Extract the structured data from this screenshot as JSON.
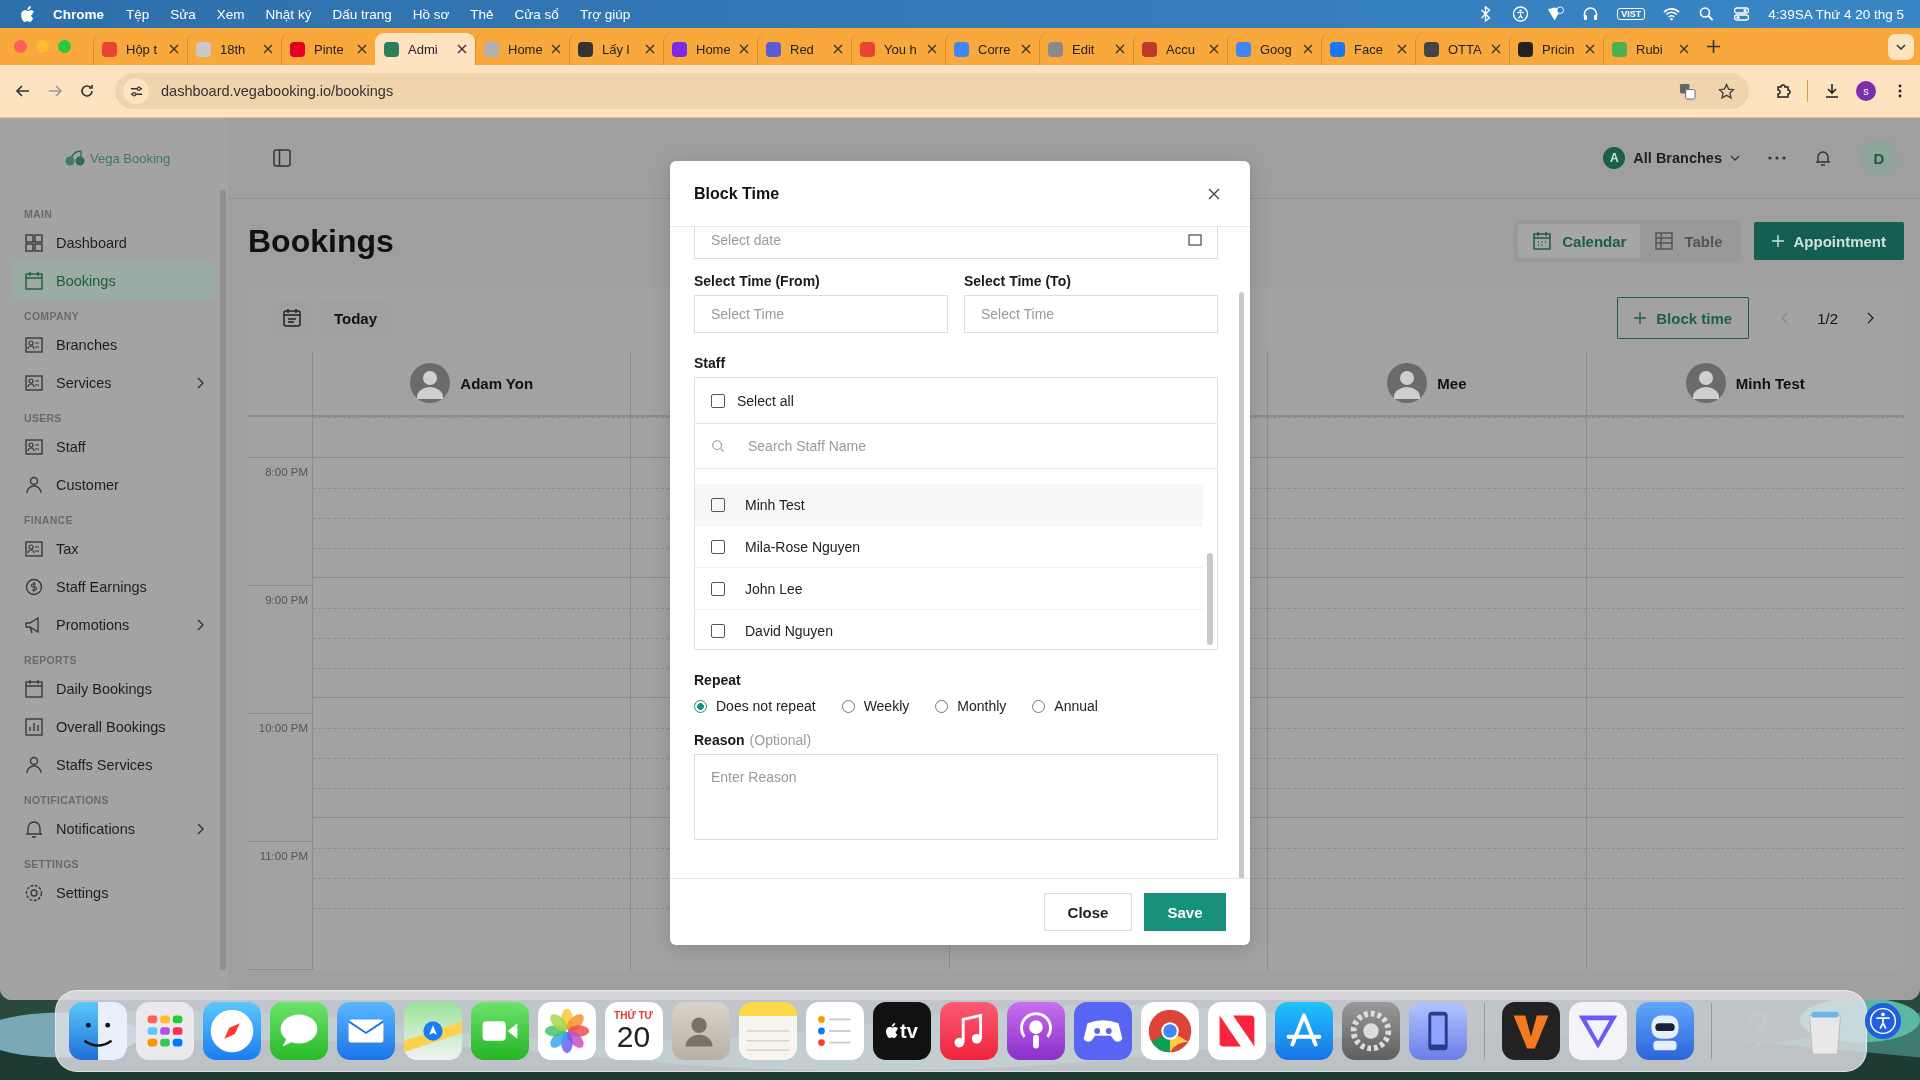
{
  "menu_bar": {
    "app": "Chrome",
    "items": [
      "Tệp",
      "Sửa",
      "Xem",
      "Nhật ký",
      "Dấu trang",
      "Hồ sơ",
      "Thẻ",
      "Cửa sổ",
      "Trợ giúp"
    ],
    "input_source": "VIST",
    "clock": "4:39SA Thứ 4 20 thg 5"
  },
  "browser": {
    "tabs": [
      {
        "title": "Hộp t",
        "color": "#ea4335",
        "selected": false
      },
      {
        "title": "18th",
        "color": "#c9c9c9",
        "selected": false
      },
      {
        "title": "Pinte",
        "color": "#e60023",
        "selected": false
      },
      {
        "title": "Admi",
        "color": "#2e7d5b",
        "selected": true
      },
      {
        "title": "Home",
        "color": "#b0b0b0",
        "selected": false
      },
      {
        "title": "Lấy l",
        "color": "#333333",
        "selected": false
      },
      {
        "title": "Home",
        "color": "#7d2ae8",
        "selected": false
      },
      {
        "title": "Red",
        "color": "#5b5bd6",
        "selected": false
      },
      {
        "title": "You h",
        "color": "#ea4335",
        "selected": false
      },
      {
        "title": "Corre",
        "color": "#4285f4",
        "selected": false
      },
      {
        "title": "Edit",
        "color": "#8a8a8a",
        "selected": false
      },
      {
        "title": "Accu",
        "color": "#c0392b",
        "selected": false
      },
      {
        "title": "Goog",
        "color": "#4285f4",
        "selected": false
      },
      {
        "title": "Face",
        "color": "#1877f2",
        "selected": false
      },
      {
        "title": "OTTA",
        "color": "#444444",
        "selected": false
      },
      {
        "title": "Pricin",
        "color": "#222222",
        "selected": false
      },
      {
        "title": "Rubi",
        "color": "#4caf50",
        "selected": false
      }
    ],
    "url": "dashboard.vegabooking.io/bookings",
    "profile_initial": "s"
  },
  "app": {
    "logo": "Vega Booking",
    "sidebar": [
      {
        "heading": "MAIN",
        "items": [
          {
            "label": "Dashboard",
            "selected": false,
            "has_submenu": false
          },
          {
            "label": "Bookings",
            "selected": true,
            "has_submenu": false
          }
        ]
      },
      {
        "heading": "COMPANY",
        "items": [
          {
            "label": "Branches",
            "selected": false,
            "has_submenu": false
          },
          {
            "label": "Services",
            "selected": false,
            "has_submenu": true
          }
        ]
      },
      {
        "heading": "USERS",
        "items": [
          {
            "label": "Staff",
            "selected": false,
            "has_submenu": false
          },
          {
            "label": "Customer",
            "selected": false,
            "has_submenu": false
          }
        ]
      },
      {
        "heading": "FINANCE",
        "items": [
          {
            "label": "Tax",
            "selected": false,
            "has_submenu": false
          },
          {
            "label": "Staff Earnings",
            "selected": false,
            "has_submenu": false
          },
          {
            "label": "Promotions",
            "selected": false,
            "has_submenu": true
          }
        ]
      },
      {
        "heading": "REPORTS",
        "items": [
          {
            "label": "Daily Bookings",
            "selected": false,
            "has_submenu": false
          },
          {
            "label": "Overall Bookings",
            "selected": false,
            "has_submenu": false
          },
          {
            "label": "Staffs Services",
            "selected": false,
            "has_submenu": false
          }
        ]
      },
      {
        "heading": "NOTIFICATIONS",
        "items": [
          {
            "label": "Notifications",
            "selected": false,
            "has_submenu": true
          }
        ]
      },
      {
        "heading": "SETTINGS",
        "items": [
          {
            "label": "Settings",
            "selected": false,
            "has_submenu": false
          }
        ]
      }
    ],
    "branch": {
      "initial": "A",
      "label": "All Branches"
    },
    "user_initial": "D",
    "title": "Bookings",
    "views": [
      {
        "label": "Calendar",
        "selected": true
      },
      {
        "label": "Table",
        "selected": false
      }
    ],
    "new_button": "Appointment",
    "today": "Today",
    "block_time_button": "Block time",
    "pager": "1/2",
    "columns": [
      {
        "name": "Adam Yon"
      },
      {},
      {},
      {
        "name": "Mee"
      },
      {
        "name": "Minh Test"
      }
    ],
    "times": [
      "8:00 PM",
      "9:00 PM",
      "10:00 PM",
      "11:00 PM"
    ]
  },
  "modal": {
    "title": "Block Time",
    "date_placeholder": "Select date",
    "time_from": {
      "label": "Select Time (From)",
      "placeholder": "Select Time"
    },
    "time_to": {
      "label": "Select Time (To)",
      "placeholder": "Select Time"
    },
    "staff_label": "Staff",
    "select_all": {
      "label": "Select all",
      "checked": false
    },
    "search_placeholder": "Search Staff Name",
    "staff": [
      {
        "name": "Minh Test",
        "checked": false
      },
      {
        "name": "Mila-Rose Nguyen",
        "checked": false
      },
      {
        "name": "John Lee",
        "checked": false
      },
      {
        "name": "David Nguyen",
        "checked": false
      }
    ],
    "repeat_label": "Repeat",
    "repeat_options": [
      {
        "label": "Does not repeat",
        "selected": true
      },
      {
        "label": "Weekly",
        "selected": false
      },
      {
        "label": "Monthly",
        "selected": false
      },
      {
        "label": "Annual",
        "selected": false
      }
    ],
    "reason_label": "Reason",
    "reason_hint": "(Optional)",
    "reason_placeholder": "Enter Reason",
    "buttons": {
      "close": "Close",
      "save": "Save"
    }
  },
  "dock": {
    "calendar_month": "THỨ TƯ",
    "calendar_day": "20",
    "tv_label": "tv"
  }
}
